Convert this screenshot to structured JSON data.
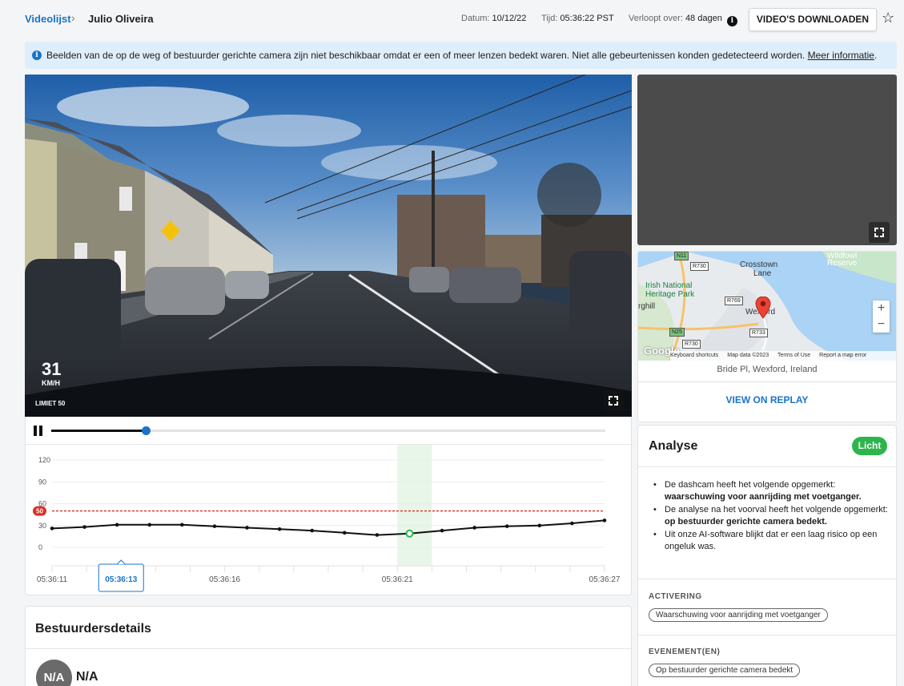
{
  "breadcrumb": {
    "root": "Videolijst",
    "separator": "›",
    "current": "Julio Oliveira"
  },
  "header": {
    "date_label": "Datum:",
    "date_value": "10/12/22",
    "time_label": "Tijd:",
    "time_value": "05:36:22 PST",
    "expires_label": "Verloopt over:",
    "expires_value": "48 dagen",
    "info_glyph": "i",
    "download_label": "VIDEO'S DOWNLOADEN",
    "star_glyph": "☆"
  },
  "banner": {
    "icon_glyph": "i",
    "text": "Beelden van de op de weg of bestuurder gerichte camera zijn niet beschikbaar omdat er een of meer lenzen bedekt waren. Niet alle gebeurtenissen konden gedetecteerd worden.",
    "link_label": "Meer informatie",
    "suffix": "."
  },
  "video": {
    "speed": "31",
    "speed_unit": "KM/H",
    "limit": "LIMIET 50"
  },
  "player": {
    "progress": 0.17
  },
  "chart_data": {
    "type": "line",
    "x": [
      "05:36:11",
      "05:36:12",
      "05:36:13",
      "05:36:14",
      "05:36:15",
      "05:36:16",
      "05:36:17",
      "05:36:18",
      "05:36:19",
      "05:36:20",
      "05:36:21",
      "05:36:22",
      "05:36:23",
      "05:36:24",
      "05:36:25",
      "05:36:26",
      "05:36:27"
    ],
    "tick_labels": [
      "05:36:11",
      "05:36:13",
      "05:36:16",
      "05:36:21",
      "05:36:27"
    ],
    "selected_tick": "05:36:13",
    "y_ticks": [
      "120",
      "90",
      "60",
      "30",
      "0"
    ],
    "ylim": [
      0,
      120
    ],
    "series": [
      {
        "values": [
          26,
          28,
          31,
          31,
          31,
          29,
          27,
          25,
          23,
          20,
          17,
          19,
          23,
          27,
          29,
          30,
          33,
          37
        ]
      }
    ],
    "speed_limit": 50,
    "speed_limit_label": "50",
    "highlight": {
      "from": "05:36:21",
      "to": "05:36:22"
    },
    "grid": true
  },
  "map": {
    "labels": [
      "Crosstown",
      "Lane",
      "Irish National",
      "Heritage Park",
      "rghill",
      "Wexford",
      "Wildfowl",
      "Reserve"
    ],
    "roads": [
      "N11",
      "R730",
      "R769",
      "N25",
      "R733",
      "R730"
    ],
    "zoom_in": "+",
    "zoom_out": "−",
    "google": "Google",
    "footer": [
      "Keyboard shortcuts",
      "Map data ©2023",
      "Terms of Use",
      "Report a map error"
    ],
    "address": "Bride Pl, Wexford, Ireland",
    "replay_label": "VIEW ON REPLAY",
    "colors": {
      "water": "#aad3f5",
      "land": "#e8ebee",
      "green": "#c8e6c9"
    }
  },
  "analysis": {
    "title": "Analyse",
    "severity": "Licht",
    "bullets": [
      {
        "text": "De dashcam heeft het volgende opgemerkt: ",
        "bold": "waarschuwing voor aanrijding met voetganger."
      },
      {
        "text": "De analyse na het voorval heeft het volgende opgemerkt: ",
        "bold": "op bestuurder gerichte camera bedekt."
      },
      {
        "text": "Uit onze AI-software blijkt dat er een laag risico op een ongeluk was.",
        "bold": ""
      }
    ],
    "activation_label": "ACTIVERING",
    "activation_tag": "Waarschuwing voor aanrijding met voetganger",
    "events_label": "EVENEMENT(EN)",
    "events_tag": "Op bestuurder gerichte camera bedekt"
  },
  "driver": {
    "title": "Bestuurdersdetails",
    "avatar": "N/A",
    "name": "N/A"
  },
  "colors": {
    "accent": "#1a73c8",
    "danger": "#d93025",
    "success": "#2db54b"
  }
}
